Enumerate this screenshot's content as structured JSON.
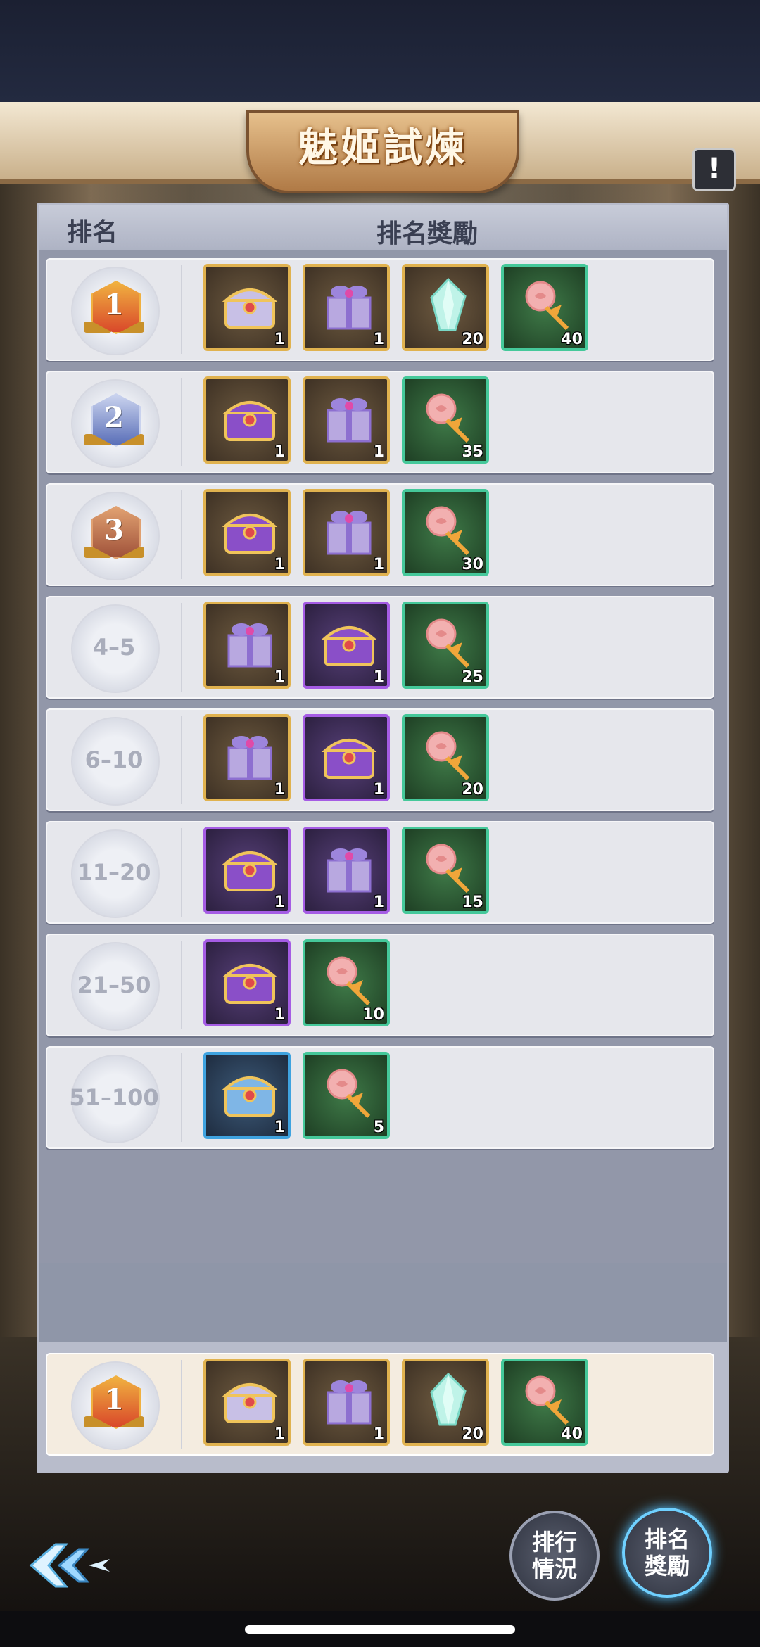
{
  "header": {
    "title": "魅姬試煉",
    "info_label": "!"
  },
  "table": {
    "col_rank": "排名",
    "col_reward": "排名獎勵"
  },
  "rows": [
    {
      "rank": "1",
      "medal": "gold",
      "items": [
        {
          "icon": "silver-chest-icon",
          "frame": "gold",
          "qty": "1"
        },
        {
          "icon": "gift-box-icon",
          "frame": "gold",
          "qty": "1"
        },
        {
          "icon": "crystal-shard-icon",
          "frame": "gold",
          "qty": "20"
        },
        {
          "icon": "rose-bouquet-icon",
          "frame": "green",
          "qty": "40"
        }
      ]
    },
    {
      "rank": "2",
      "medal": "silver",
      "items": [
        {
          "icon": "purple-chest-icon",
          "frame": "gold",
          "qty": "1"
        },
        {
          "icon": "gift-box-icon",
          "frame": "gold",
          "qty": "1"
        },
        {
          "icon": "rose-bouquet-icon",
          "frame": "green",
          "qty": "35"
        }
      ]
    },
    {
      "rank": "3",
      "medal": "bronze",
      "items": [
        {
          "icon": "purple-chest-icon",
          "frame": "gold",
          "qty": "1"
        },
        {
          "icon": "gift-box-icon",
          "frame": "gold",
          "qty": "1"
        },
        {
          "icon": "rose-bouquet-icon",
          "frame": "green",
          "qty": "30"
        }
      ]
    },
    {
      "rank": "4–5",
      "medal": "",
      "items": [
        {
          "icon": "gift-box-icon",
          "frame": "gold",
          "qty": "1"
        },
        {
          "icon": "purple-chest-icon",
          "frame": "purple",
          "qty": "1"
        },
        {
          "icon": "rose-bouquet-icon",
          "frame": "green",
          "qty": "25"
        }
      ]
    },
    {
      "rank": "6–10",
      "medal": "",
      "items": [
        {
          "icon": "gift-box-icon",
          "frame": "gold",
          "qty": "1"
        },
        {
          "icon": "purple-chest-icon",
          "frame": "purple",
          "qty": "1"
        },
        {
          "icon": "rose-bouquet-icon",
          "frame": "green",
          "qty": "20"
        }
      ]
    },
    {
      "rank": "11–20",
      "medal": "",
      "items": [
        {
          "icon": "purple-chest-icon",
          "frame": "purple",
          "qty": "1"
        },
        {
          "icon": "gift-box-icon",
          "frame": "purple",
          "qty": "1"
        },
        {
          "icon": "rose-bouquet-icon",
          "frame": "green",
          "qty": "15"
        }
      ]
    },
    {
      "rank": "21–50",
      "medal": "",
      "items": [
        {
          "icon": "purple-chest-icon",
          "frame": "purple",
          "qty": "1"
        },
        {
          "icon": "rose-bouquet-icon",
          "frame": "green",
          "qty": "10"
        }
      ]
    },
    {
      "rank": "51–100",
      "medal": "",
      "items": [
        {
          "icon": "blue-chest-icon",
          "frame": "blue",
          "qty": "1"
        },
        {
          "icon": "rose-bouquet-icon",
          "frame": "green",
          "qty": "5"
        }
      ]
    }
  ],
  "my_rank": {
    "rank": "1",
    "items": [
      {
        "icon": "silver-chest-icon",
        "frame": "gold",
        "qty": "1"
      },
      {
        "icon": "gift-box-icon",
        "frame": "gold",
        "qty": "1"
      },
      {
        "icon": "crystal-shard-icon",
        "frame": "gold",
        "qty": "20"
      },
      {
        "icon": "rose-bouquet-icon",
        "frame": "green",
        "qty": "40"
      }
    ]
  },
  "buttons": {
    "ranking_status": [
      "排行",
      "情況"
    ],
    "ranking_reward": [
      "排名",
      "獎勵"
    ]
  },
  "colors": {
    "gold_frame": "#e0b24f",
    "purple_frame": "#a55ce4",
    "green_frame": "#45c89a",
    "blue_frame": "#3fa3e0"
  }
}
